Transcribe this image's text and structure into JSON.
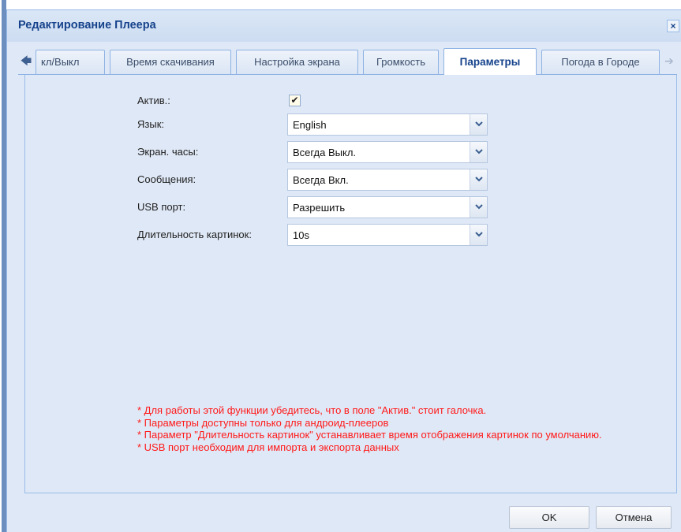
{
  "dialog": {
    "title": "Редактирование Плеера",
    "close_glyph": "×"
  },
  "tabs": {
    "scroll_left_glyph": "🡄",
    "scroll_right_glyph": "➔",
    "items": [
      {
        "label": "кл/Выкл",
        "active": false
      },
      {
        "label": "Время скачивания",
        "active": false
      },
      {
        "label": "Настройка экрана",
        "active": false
      },
      {
        "label": "Громкость",
        "active": false
      },
      {
        "label": "Параметры",
        "active": true
      },
      {
        "label": "Погода в Городе",
        "active": false
      }
    ]
  },
  "form": {
    "active": {
      "label": "Актив.:",
      "checked": true,
      "check_glyph": "✔"
    },
    "language": {
      "label": "Язык:",
      "value": "English"
    },
    "screen_clock": {
      "label": "Экран. часы:",
      "value": "Всегда Выкл."
    },
    "messages": {
      "label": "Сообщения:",
      "value": "Всегда Вкл."
    },
    "usb_port": {
      "label": "USB порт:",
      "value": "Разрешить"
    },
    "image_duration": {
      "label": "Длительность картинок:",
      "value": "10s"
    }
  },
  "notes": [
    "* Для работы этой функции убедитесь, что в поле \"Актив.\" стоит галочка.",
    "* Параметры доступны только для андроид-плееров",
    "* Параметр \"Длительность картинок\" устанавливает время отображения картинок по умолчанию.",
    "* USB порт необходим для импорта и экспорта данных"
  ],
  "buttons": {
    "ok": "OK",
    "cancel": "Отмена"
  },
  "colors": {
    "title_text": "#15428b",
    "panel_bg": "#dfe8f6",
    "border": "#99bbe8",
    "note_text": "#ff1a1a"
  }
}
